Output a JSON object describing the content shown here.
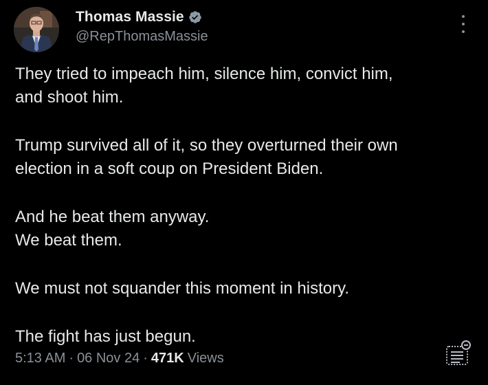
{
  "author": {
    "name": "Thomas Massie",
    "handle": "@RepThomasMassie",
    "verified_color": "#8b98a5"
  },
  "tweet": {
    "paragraphs": [
      [
        "They tried to impeach him, silence him, convict him,",
        "and shoot him."
      ],
      [
        "Trump survived all of it, so they overturned their own",
        "election in a soft coup on President Biden."
      ],
      [
        "And he beat them anyway.",
        "We beat them."
      ],
      [
        "We must not squander this moment in history."
      ],
      [
        "The fight has just begun."
      ]
    ],
    "time": "5:13 AM",
    "date": "06 Nov 24",
    "views_count": "471K",
    "views_label": "Views",
    "separator": "·"
  },
  "icons": {
    "more": "more-vertical-icon",
    "verified": "verified-badge-icon",
    "translate": "translate-text-icon"
  },
  "colors": {
    "background": "#000000",
    "text": "#e7e9ea",
    "secondary": "#8b9098"
  }
}
